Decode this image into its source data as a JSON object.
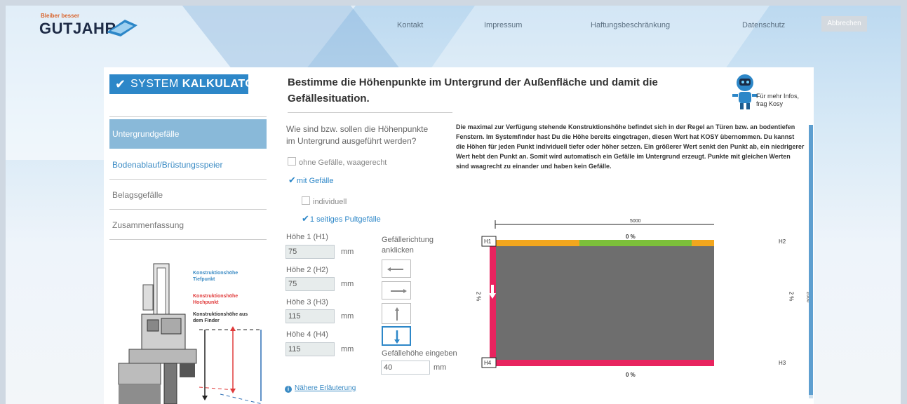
{
  "header": {
    "logo_tag": "Bleiber besser",
    "logo_name": "GUTJAHR",
    "nav": [
      "Kontakt",
      "Impressum",
      "Haftungsbeschränkung",
      "Datenschutz"
    ],
    "cancel_label": "Abbrechen"
  },
  "sidebar": {
    "system_label_prefix": "SYSTEM",
    "system_label_bold": "KALKULATOR",
    "items": [
      {
        "label": "Untergrundgefälle",
        "state": "active"
      },
      {
        "label": "Bodenablauf/Brüstungsspeier",
        "state": "link"
      },
      {
        "label": "Belagsgefälle",
        "state": "normal"
      },
      {
        "label": "Zusammenfassung",
        "state": "normal"
      }
    ],
    "diagram_labels": [
      {
        "text": "Konstruktionshöhe Tiefpunkt",
        "color": "#3b8bc4"
      },
      {
        "text": "Konstruktionshöhe Hochpunkt",
        "color": "#e03a3a"
      },
      {
        "text": "Konstruktionshöhe aus dem Finder",
        "color": "#333333"
      }
    ]
  },
  "main": {
    "heading": "Bestimme die Höhenpunkte im Untergrund der Außenfläche und damit die Gefällesituation.",
    "kosy_hint": "Für mehr Infos, frag Kosy",
    "question": "Wie sind bzw. sollen die Höhenpunkte im Untergrund ausgeführt werden?",
    "options": {
      "no_slope": "ohne Gefälle, waagerecht",
      "with_slope": "mit Gefälle",
      "individual": "individuell",
      "one_sided": "1 seitiges Pultgefälle"
    },
    "heights": [
      {
        "label": "Höhe 1 (H1)",
        "value": "75",
        "unit": "mm"
      },
      {
        "label": "Höhe 2 (H2)",
        "value": "75",
        "unit": "mm"
      },
      {
        "label": "Höhe 3 (H3)",
        "value": "115",
        "unit": "mm"
      },
      {
        "label": "Höhe 4 (H4)",
        "value": "115",
        "unit": "mm"
      }
    ],
    "direction_label": "Gefällerichtung anklicken",
    "slope_height_label": "Gefällehöhe eingeben",
    "slope_height_value": "40",
    "slope_height_unit": "mm",
    "info_link": "Nähere Erläuterung",
    "paragraph": "Die maximal zur Verfügung stehende Konstruktionshöhe befindet sich in der Regel an Türen bzw. an bodentiefen Fenstern. Im Systemfinder hast Du die Höhe bereits eingetragen, diesen Wert hat KOSY übernommen. Du kannst die Höhen für jeden Punkt individuell tiefer oder höher setzen. Ein größerer Wert senkt den Punkt ab, ein niedrigerer Wert hebt den Punkt an. Somit wird automatisch ein Gefälle im Untergrund erzeugt. Punkte mit gleichen Werten sind waagrecht zu einander und haben kein Gefälle."
  },
  "plan": {
    "width_dim": "5000",
    "height_dim": "2000",
    "top_pct": "0 %",
    "bottom_pct": "0 %",
    "left_pct": "2 %",
    "right_pct": "2 %",
    "corners": [
      "H1",
      "H2",
      "H3",
      "H4"
    ],
    "colors": {
      "edge": "#e8245f",
      "top_edge": "#f2a61e",
      "top_mid": "#7cbf3a",
      "fill": "#6e6e6e"
    }
  },
  "colors": {
    "accent": "#2d87c8",
    "active_nav": "#89b9d9"
  }
}
